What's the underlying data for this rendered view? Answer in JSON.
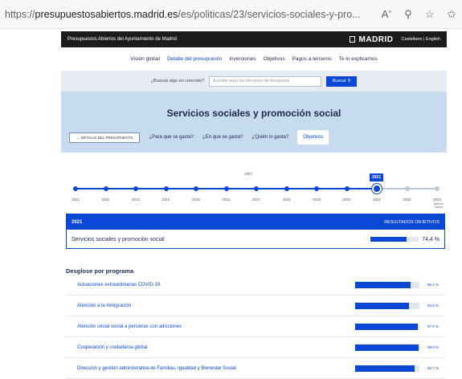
{
  "browser": {
    "url_prefix": "https://",
    "url_host": "presupuestosabiertos.madrid.es",
    "url_path": "/es/politicas/23/servicios-sociales-y-pro...",
    "icons": [
      "read-aloud-icon",
      "zoom-icon",
      "favorite-icon",
      "favorites-bar-icon"
    ]
  },
  "site": {
    "portal_name": "Presupuestos Abiertos del Ayuntamiento de Madrid",
    "brand": "MADRID",
    "languages": "Castellano | English"
  },
  "nav": {
    "items": [
      {
        "label": "Visión global",
        "active": false
      },
      {
        "label": "Detalle del presupuesto",
        "active": true
      },
      {
        "label": "Inversiones",
        "active": false
      },
      {
        "label": "Objetivos",
        "active": false
      },
      {
        "label": "Pagos a terceros",
        "active": false
      },
      {
        "label": "Te lo explicamos",
        "active": false
      }
    ]
  },
  "search": {
    "label": "¿Buscas algo en concreto?",
    "placeholder": "Escribe aquí los términos de búsqueda",
    "button": "Buscar"
  },
  "hero": {
    "title": "Servicios sociales y promoción social",
    "back_button": "← DETALLE DEL PRESUPUESTO",
    "tabs": [
      {
        "label": "¿Para qué se gasta?",
        "active": false
      },
      {
        "label": "¿En qué se gasta?",
        "active": false
      },
      {
        "label": "¿Quién lo gasta?",
        "active": false
      },
      {
        "label": "Objetivos",
        "active": true
      }
    ]
  },
  "timeline": {
    "label": "AÑO",
    "years": [
      "2011",
      "2012",
      "2013",
      "2014",
      "2015",
      "2016",
      "2017",
      "2018",
      "2019",
      "2020",
      "2021",
      "2022",
      "2023"
    ],
    "selected": "2021",
    "extra_note": "(año en curso)"
  },
  "result": {
    "year": "2021",
    "header_right": "RESULTADOS OBJETIVOS",
    "name": "Servicios sociales y promoción social",
    "percent_value": 74.4,
    "percent_label": "74,4 %"
  },
  "desglose": {
    "title": "Desglose por programa",
    "programs": [
      {
        "name": "Actuaciones extraordinarias COVID-19",
        "value": 86.1,
        "label": "86,1 %"
      },
      {
        "name": "Atención a la inmigración",
        "value": 83.5,
        "label": "83,5 %"
      },
      {
        "name": "Atención social social a personas con adicciones",
        "value": 97.0,
        "label": "97,0 %"
      },
      {
        "name": "Cooperación y ciudadanía global",
        "value": 99.0,
        "label": "99,0 %"
      },
      {
        "name": "Dirección y gestión administrativa de Familias, Igualdad y Bienestar Social",
        "value": 92.7,
        "label": "92,7 %"
      }
    ]
  },
  "colors": {
    "accent": "#0a47d6",
    "hero_bg": "#c6dbef",
    "top_bar": "#1c1c1c"
  }
}
